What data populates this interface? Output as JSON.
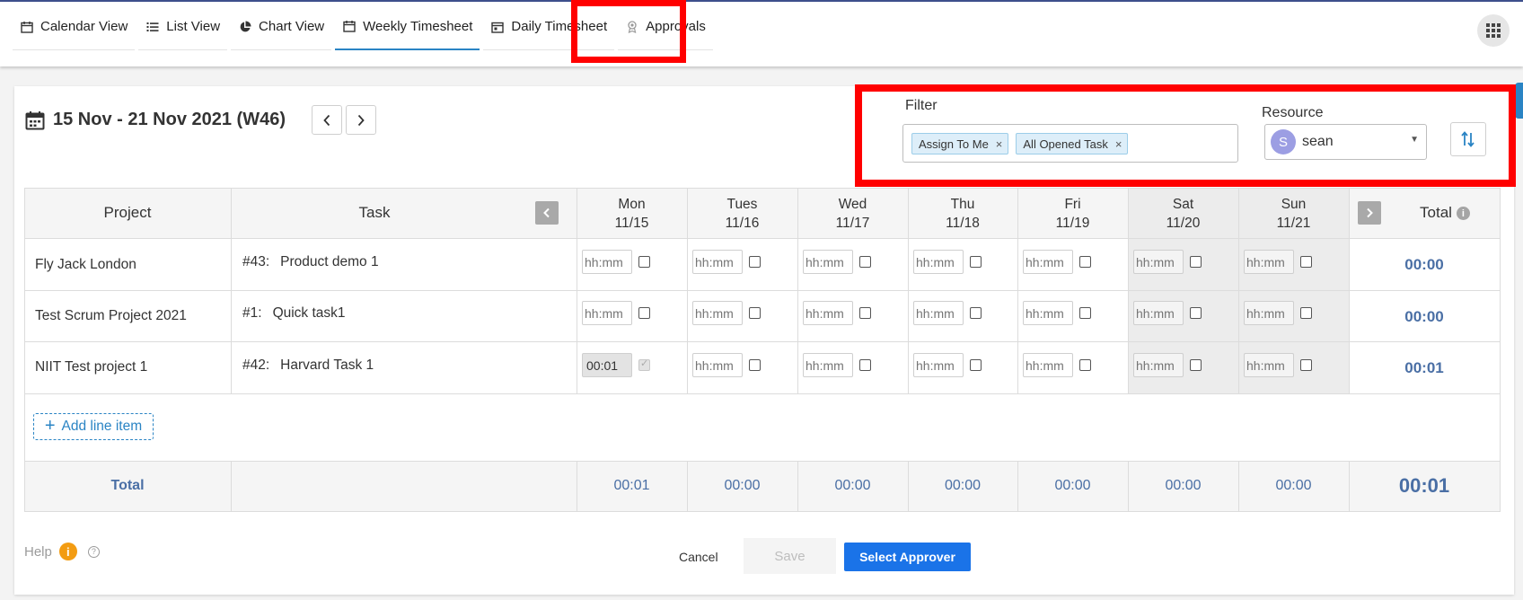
{
  "nav": {
    "tabs": [
      {
        "label": "Calendar View",
        "icon": "calendar-icon"
      },
      {
        "label": "List View",
        "icon": "list-icon"
      },
      {
        "label": "Chart View",
        "icon": "pie-chart-icon"
      },
      {
        "label": "Weekly Timesheet",
        "icon": "calendar-icon",
        "active": true
      },
      {
        "label": "Daily Timesheet",
        "icon": "calendar-day-icon"
      },
      {
        "label": "Approvals",
        "icon": "approval-icon"
      }
    ]
  },
  "week": {
    "title": "15 Nov - 21 Nov 2021 (W46)"
  },
  "filter": {
    "label": "Filter",
    "chips": [
      "Assign To Me",
      "All Opened Task"
    ],
    "remove_glyph": "×"
  },
  "resource": {
    "label": "Resource",
    "avatar_initial": "S",
    "value": "sean"
  },
  "table": {
    "headers": {
      "project": "Project",
      "task": "Task",
      "total": "Total",
      "info_glyph": "i"
    },
    "days": [
      {
        "name": "Mon",
        "date": "11/15"
      },
      {
        "name": "Tues",
        "date": "11/16"
      },
      {
        "name": "Wed",
        "date": "11/17"
      },
      {
        "name": "Thu",
        "date": "11/18"
      },
      {
        "name": "Fri",
        "date": "11/19"
      },
      {
        "name": "Sat",
        "date": "11/20"
      },
      {
        "name": "Sun",
        "date": "11/21"
      }
    ],
    "placeholder": "hh:mm",
    "rows": [
      {
        "project": "Fly Jack London",
        "task_num": "#43:",
        "task": "Product demo 1",
        "mon": "",
        "total": "00:00"
      },
      {
        "project": "Test Scrum Project 2021",
        "task_num": "#1:",
        "task": "Quick task1",
        "mon": "",
        "total": "00:00"
      },
      {
        "project": "NIIT Test project 1",
        "task_num": "#42:",
        "task": "Harvard Task 1",
        "mon": "00:01",
        "total": "00:01"
      }
    ],
    "add_line": "Add line item",
    "totals": {
      "label": "Total",
      "days": [
        "00:01",
        "00:00",
        "00:00",
        "00:00",
        "00:00",
        "00:00",
        "00:00"
      ],
      "grand": "00:01"
    }
  },
  "footer": {
    "help": "Help",
    "help_info_glyph": "i",
    "help_q_glyph": "?",
    "cancel": "Cancel",
    "save": "Save",
    "select_approver": "Select Approver"
  },
  "colors": {
    "accent": "#2a84c4",
    "primary_button": "#1a73e8",
    "highlight": "#ff0000",
    "total_text": "#4a6fa5"
  }
}
